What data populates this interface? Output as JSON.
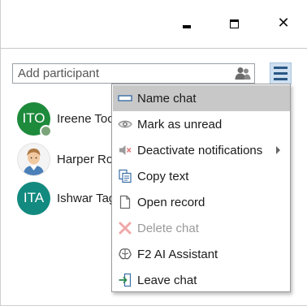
{
  "window": {
    "minimize_icon": "minimize-icon",
    "maximize_icon": "maximize-icon",
    "close_glyph": "✕"
  },
  "search": {
    "placeholder": "Add participant",
    "icon": "people-icon"
  },
  "menu_button": {
    "icon": "hamburger-menu-icon"
  },
  "participants": [
    {
      "initials": "ITO",
      "name": "Ireene Too",
      "avatar_color": "#1e8a3c",
      "status_color": "#7aa57a"
    },
    {
      "initials": "",
      "name": "Harper Ro",
      "avatar_color": "#f2f2f2"
    },
    {
      "initials": "ITA",
      "name": "Ishwar Tag",
      "avatar_color": "#138a7f"
    }
  ],
  "context_menu": {
    "items": [
      {
        "label": "Name chat",
        "icon": "rename-icon",
        "highlighted": true,
        "disabled": false
      },
      {
        "label": "Mark as unread",
        "icon": "eye-icon",
        "highlighted": false,
        "disabled": false
      },
      {
        "label": "Deactivate notifications",
        "icon": "mute-speaker-icon",
        "highlighted": false,
        "disabled": false,
        "has_submenu": true
      },
      {
        "label": "Copy text",
        "icon": "copy-icon",
        "highlighted": false,
        "disabled": false
      },
      {
        "label": "Open record",
        "icon": "document-icon",
        "highlighted": false,
        "disabled": false
      },
      {
        "label": "Delete chat",
        "icon": "delete-x-icon",
        "highlighted": false,
        "disabled": true
      },
      {
        "label": "F2 AI Assistant",
        "icon": "brain-icon",
        "highlighted": false,
        "disabled": false
      },
      {
        "label": "Leave chat",
        "icon": "exit-icon",
        "highlighted": false,
        "disabled": false
      }
    ]
  },
  "colors": {
    "accent": "#2a5885",
    "menu_highlight": "#c8c8c8",
    "menu_button_bg": "#cfe0f0"
  }
}
